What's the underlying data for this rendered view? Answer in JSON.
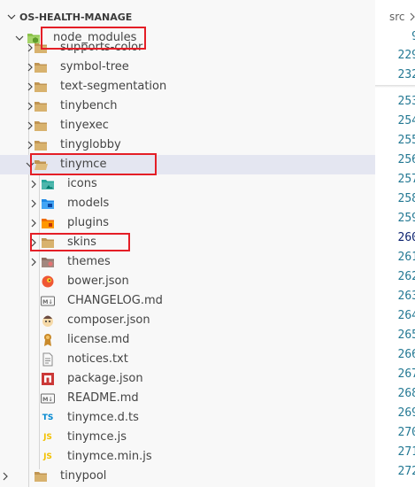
{
  "explorer": {
    "section_title": "OS-HEALTH-MANAGE",
    "rows": [
      {
        "label": "node_modules",
        "kind": "folder",
        "icon": "node-folder-icon",
        "twisty": "expanded"
      },
      {
        "label": "supports-color",
        "kind": "folder",
        "icon": "folder-icon",
        "twisty": "collapsed"
      },
      {
        "label": "symbol-tree",
        "kind": "folder",
        "icon": "folder-icon",
        "twisty": "collapsed"
      },
      {
        "label": "text-segmentation",
        "kind": "folder",
        "icon": "folder-icon",
        "twisty": "collapsed"
      },
      {
        "label": "tinybench",
        "kind": "folder",
        "icon": "folder-icon",
        "twisty": "collapsed"
      },
      {
        "label": "tinyexec",
        "kind": "folder",
        "icon": "folder-icon",
        "twisty": "collapsed"
      },
      {
        "label": "tinyglobby",
        "kind": "folder",
        "icon": "folder-icon",
        "twisty": "collapsed"
      },
      {
        "label": "tinymce",
        "kind": "folder",
        "icon": "open-folder-icon",
        "twisty": "expanded",
        "selected": true
      },
      {
        "label": "icons",
        "kind": "folder",
        "icon": "images-folder-icon",
        "twisty": "collapsed"
      },
      {
        "label": "models",
        "kind": "folder",
        "icon": "models-folder-icon",
        "twisty": "collapsed"
      },
      {
        "label": "plugins",
        "kind": "folder",
        "icon": "plugins-folder-icon",
        "twisty": "collapsed"
      },
      {
        "label": "skins",
        "kind": "folder",
        "icon": "folder-icon",
        "twisty": "collapsed"
      },
      {
        "label": "themes",
        "kind": "folder",
        "icon": "themes-folder-icon",
        "twisty": "collapsed"
      },
      {
        "label": "bower.json",
        "kind": "file",
        "icon": "bower-icon"
      },
      {
        "label": "CHANGELOG.md",
        "kind": "file",
        "icon": "markdown-icon"
      },
      {
        "label": "composer.json",
        "kind": "file",
        "icon": "composer-icon"
      },
      {
        "label": "license.md",
        "kind": "file",
        "icon": "license-icon"
      },
      {
        "label": "notices.txt",
        "kind": "file",
        "icon": "text-file-icon"
      },
      {
        "label": "package.json",
        "kind": "file",
        "icon": "npm-icon"
      },
      {
        "label": "README.md",
        "kind": "file",
        "icon": "markdown-icon"
      },
      {
        "label": "tinymce.d.ts",
        "kind": "file",
        "icon": "typescript-icon"
      },
      {
        "label": "tinymce.js",
        "kind": "file",
        "icon": "javascript-icon"
      },
      {
        "label": "tinymce.min.js",
        "kind": "file",
        "icon": "javascript-icon"
      },
      {
        "label": "tinypool",
        "kind": "folder",
        "icon": "folder-icon",
        "twisty": "collapsed"
      }
    ],
    "icon_text": {
      "ts": "TS",
      "js": "JS",
      "md": "M↓"
    },
    "colors": {
      "highlight_box": "#e41e26",
      "selected_row": "#e4e6f1",
      "folder": "#c09553",
      "ts": "#0288d1",
      "js": "#f2c100"
    }
  },
  "editor": {
    "breadcrumb": "src",
    "line_numbers": [
      "9",
      "229",
      "232",
      "253",
      "254",
      "255",
      "256",
      "257",
      "258",
      "259",
      "260",
      "261",
      "262",
      "263",
      "264",
      "265",
      "266",
      "267",
      "268",
      "269",
      "270",
      "271",
      "272"
    ],
    "current_line": "260",
    "colors": {
      "line_number": "#237893",
      "current_line_number": "#0b216f"
    }
  }
}
